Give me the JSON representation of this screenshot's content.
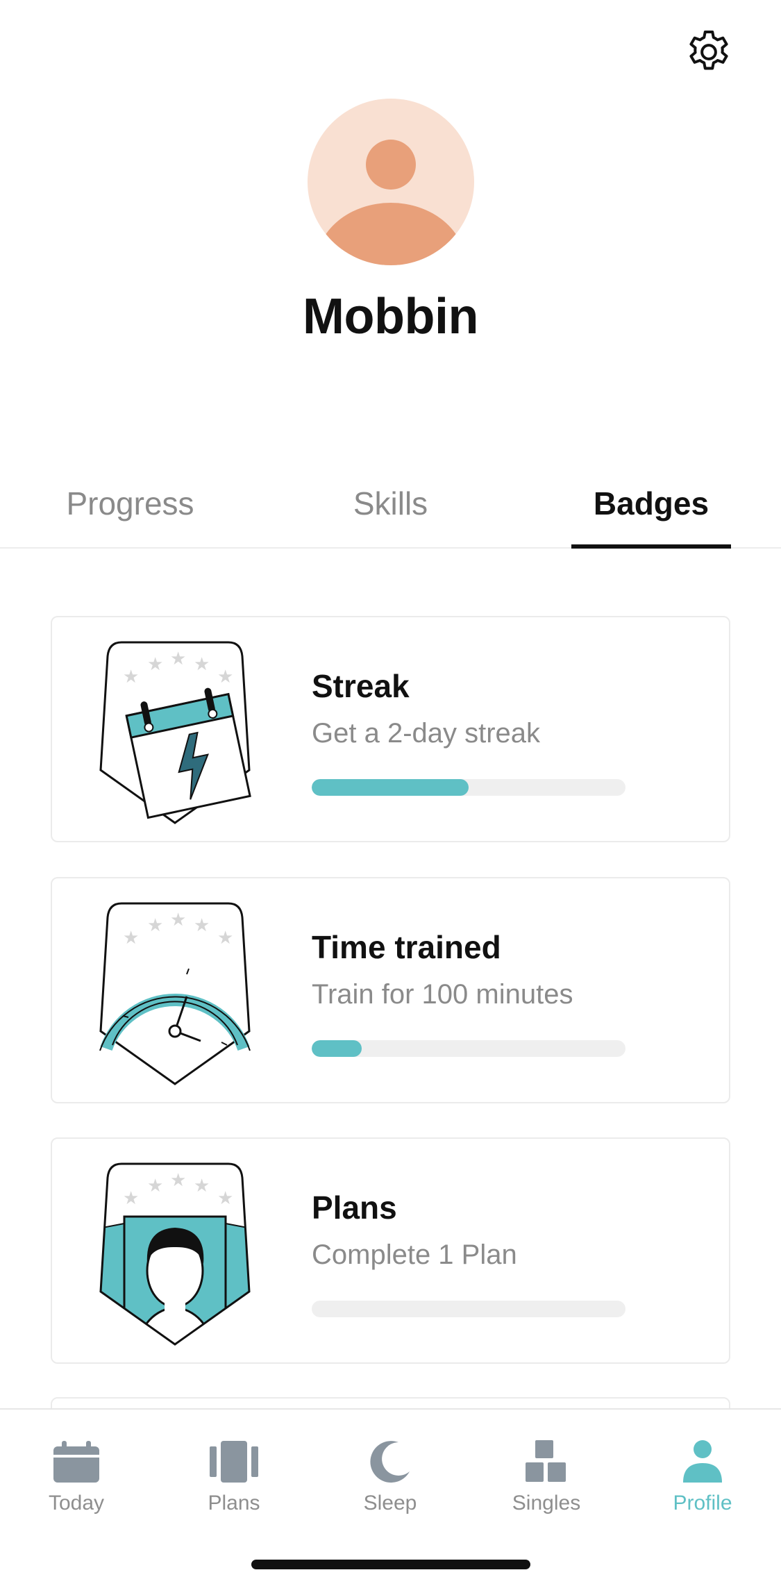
{
  "header": {
    "settings_icon": "gear-icon",
    "profile_name": "Mobbin"
  },
  "tabs": [
    {
      "label": "Progress",
      "active": false
    },
    {
      "label": "Skills",
      "active": false
    },
    {
      "label": "Badges",
      "active": true
    }
  ],
  "badges": [
    {
      "title": "Streak",
      "description": "Get a 2-day streak",
      "progress": 0.5,
      "icon": "calendar-lightning-icon"
    },
    {
      "title": "Time trained",
      "description": "Train for 100 minutes",
      "progress": 0.16,
      "icon": "clock-icon"
    },
    {
      "title": "Plans",
      "description": "Complete 1 Plan",
      "progress": 0.0,
      "icon": "person-book-icon"
    }
  ],
  "bottom_nav": [
    {
      "label": "Today",
      "icon": "calendar-icon",
      "active": false
    },
    {
      "label": "Plans",
      "icon": "plans-icon",
      "active": false
    },
    {
      "label": "Sleep",
      "icon": "moon-icon",
      "active": false
    },
    {
      "label": "Singles",
      "icon": "blocks-icon",
      "active": false
    },
    {
      "label": "Profile",
      "icon": "person-icon",
      "active": true
    }
  ],
  "colors": {
    "accent": "#5fc0c5",
    "accent_dark": "#2f6c7c",
    "avatar_bg": "#f9e0d2",
    "avatar_fg": "#e8a07a",
    "inactive": "#8e8e8e"
  }
}
